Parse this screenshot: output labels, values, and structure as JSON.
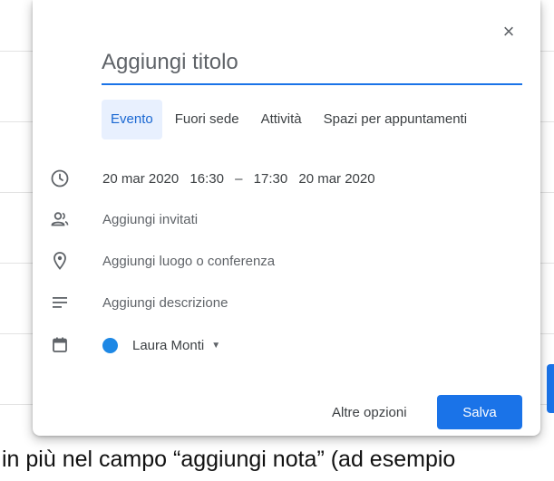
{
  "dialog": {
    "title_placeholder": "Aggiungi titolo",
    "tabs": [
      {
        "label": "Evento",
        "active": true
      },
      {
        "label": "Fuori sede",
        "active": false
      },
      {
        "label": "Attività",
        "active": false
      },
      {
        "label": "Spazi per appuntamenti",
        "active": false
      }
    ],
    "datetime": {
      "start_date": "20 mar 2020",
      "start_time": "16:30",
      "separator": "–",
      "end_time": "17:30",
      "end_date": "20 mar 2020"
    },
    "guests_placeholder": "Aggiungi invitati",
    "location_placeholder": "Aggiungi luogo o conferenza",
    "description_placeholder": "Aggiungi descrizione",
    "calendar_owner": "Laura Monti",
    "calendar_color": "#1e88e5",
    "more_options_label": "Altre opzioni",
    "save_label": "Salva",
    "close_label": "×"
  },
  "caption_text": "in più nel campo “aggiungi nota” (ad esempio",
  "colors": {
    "accent": "#1a73e8",
    "tab_active_bg": "#e8f0fe"
  }
}
